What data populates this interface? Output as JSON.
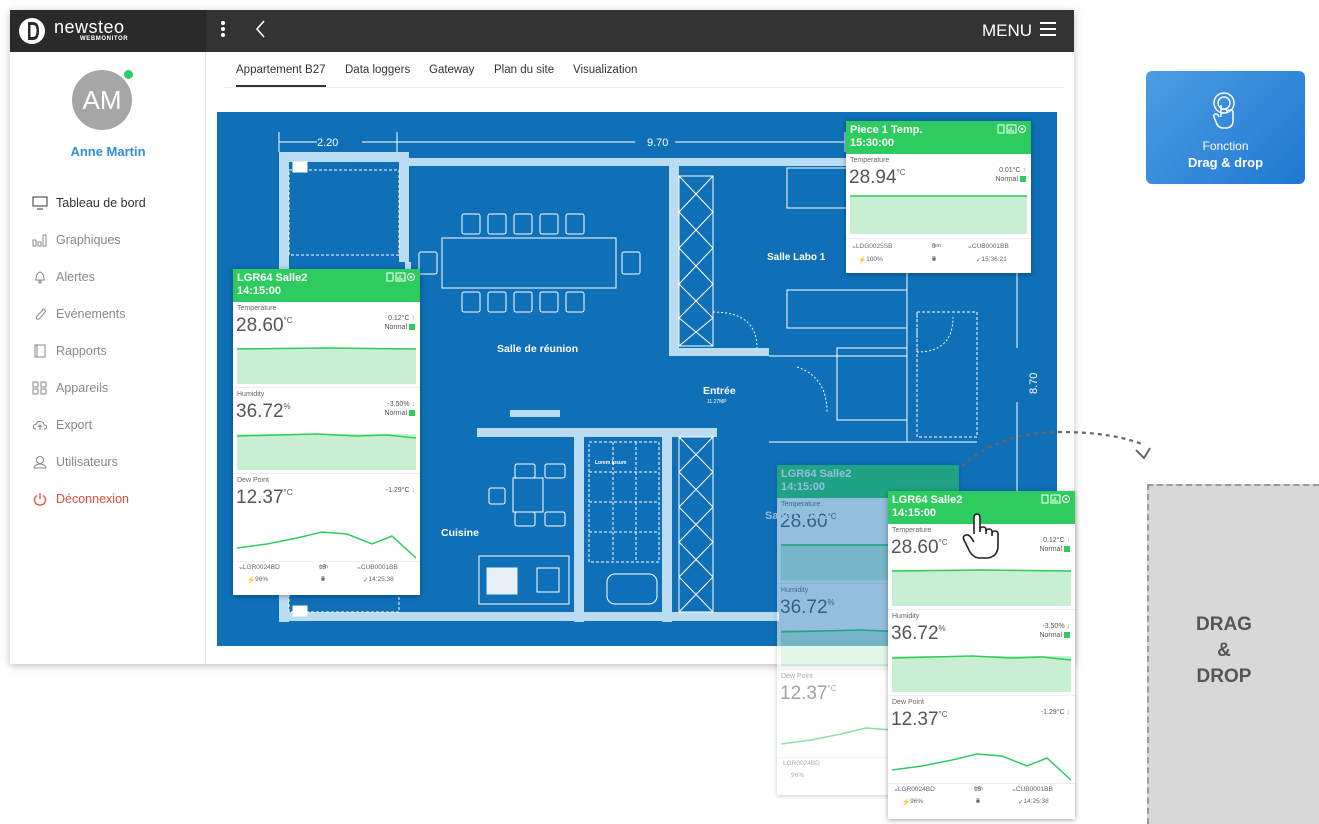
{
  "brand": {
    "name": "newsteo",
    "sub": "WEBMONITOR"
  },
  "topbar": {
    "menu_label": "MENU"
  },
  "user": {
    "initials": "AM",
    "name": "Anne Martin"
  },
  "nav": [
    {
      "label": "Tableau de bord",
      "icon": "monitor-icon"
    },
    {
      "label": "Graphiques",
      "icon": "bar-chart-icon"
    },
    {
      "label": "Alertes",
      "icon": "bell-icon"
    },
    {
      "label": "Evénements",
      "icon": "paperclip-icon"
    },
    {
      "label": "Rapports",
      "icon": "book-icon"
    },
    {
      "label": "Appareils",
      "icon": "grid-icon"
    },
    {
      "label": "Export",
      "icon": "cloud-upload-icon"
    },
    {
      "label": "Utilisateurs",
      "icon": "user-icon"
    },
    {
      "label": "Déconnexion",
      "icon": "power-icon"
    }
  ],
  "tabs": [
    "Appartement B27",
    "Data loggers",
    "Gateway",
    "Plan du site",
    "Visualization"
  ],
  "plan": {
    "dims": {
      "top_left": "2.20",
      "top_right": "9.70",
      "right": "8.70"
    },
    "rooms": {
      "salle_labo1": "Salle Labo 1",
      "reunion": "Salle de réunion",
      "entree": "Entrée",
      "entree_sub": "11.27MP",
      "cuisine": "Cuisine",
      "salle_labo2": "Salle Labo 2",
      "lorem": "Lorem Ipsum"
    }
  },
  "widget_piece1": {
    "title": "Piece 1 Temp.",
    "time": "15:30:00",
    "label": "Temperature",
    "value": "28.94",
    "unit": "°C",
    "delta": "0.01°C",
    "status": "Normal",
    "logger": "LDG0025SB",
    "interval": "5",
    "interval_unit": "min",
    "gateway": "CUB0001BB",
    "battery": "100%",
    "signal": "7",
    "last": "15:36:21"
  },
  "widget_lgr": {
    "title": "LGR64 Salle2",
    "time": "14:15:00",
    "temp_label": "Temperature",
    "temp_value": "28.60",
    "temp_unit": "°C",
    "temp_delta": "0.12°C",
    "temp_status": "Normal",
    "hum_label": "Humidity",
    "hum_value": "36.72",
    "hum_unit": "%",
    "hum_delta": "-3.50%",
    "hum_status": "Normal",
    "dew_label": "Dew Point",
    "dew_value": "12.37",
    "dew_unit": "°C",
    "dew_delta": "-1.29°C",
    "logger": "LGR0024BD",
    "interval": "15",
    "interval_unit": "min",
    "gateway": "CUB0001BB",
    "battery": "96%",
    "signal": "7",
    "last": "14:25:38"
  },
  "badge": {
    "line1": "Fonction",
    "line2": "Drag & drop"
  },
  "drop_zone": {
    "l1": "DRAG",
    "l2": "&",
    "l3": "DROP"
  },
  "colors": {
    "green": "#2ecc5e",
    "blueprint": "#0f6fb7",
    "accent": "#2f8fd8",
    "logout": "#e34c3b"
  }
}
